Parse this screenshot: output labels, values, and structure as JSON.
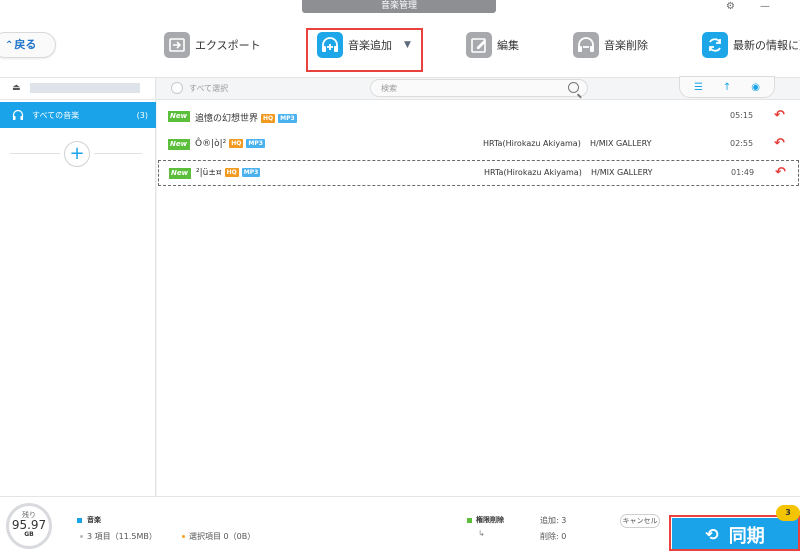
{
  "window": {
    "title": "音楽管理",
    "settings_icon": "gear-icon",
    "minimize": "—"
  },
  "toolbar": {
    "back_label": "戻る",
    "items": [
      {
        "label": "エクスポート",
        "icon": "export-icon"
      },
      {
        "label": "音楽追加",
        "icon": "headphones-add-icon"
      },
      {
        "label": "編集",
        "icon": "edit-icon"
      },
      {
        "label": "音楽削除",
        "icon": "headphones-remove-icon"
      },
      {
        "label": "最新の情報に更",
        "icon": "refresh-icon"
      }
    ]
  },
  "sidebar": {
    "library_label": "すべての音楽",
    "library_count": "(3)",
    "add_icon": "plus-icon"
  },
  "list": {
    "select_all": "すべて選択",
    "search_placeholder": "検索",
    "rows": [
      {
        "badge": "New",
        "title": "追憶の幻想世界",
        "hq": "HQ",
        "format": "MP3",
        "artist": "",
        "album": "",
        "duration": "05:15"
      },
      {
        "badge": "New",
        "title": "Ô®|ò|²",
        "hq": "HQ",
        "format": "MP3",
        "artist": "HRTa(Hirokazu Akiyama)",
        "album": "H/MIX GALLERY",
        "duration": "02:55"
      },
      {
        "badge": "New",
        "title": "²|ü±¤",
        "hq": "HQ",
        "format": "MP3",
        "artist": "HRTa(Hirokazu Akiyama)",
        "album": "H/MIX GALLERY",
        "duration": "01:49"
      }
    ]
  },
  "footer": {
    "gauge_label": "残り",
    "gauge_value": "95.97",
    "gauge_unit": "GB",
    "music_label": "音楽",
    "items_text": "3 項目（11.5MB）",
    "selected_text": "選択項目 0（0B）",
    "permission_label": "権限削除",
    "add_text": "追加:  3",
    "delete_text": "削除:  0",
    "cancel_label": "キャンセル",
    "sync_label": "同期",
    "sync_badge": "3",
    "colors": {
      "music": "#1aa3e8",
      "permission": "#5cbf3b",
      "accent": "#1aa3e8",
      "highlight": "#e8413e"
    }
  }
}
